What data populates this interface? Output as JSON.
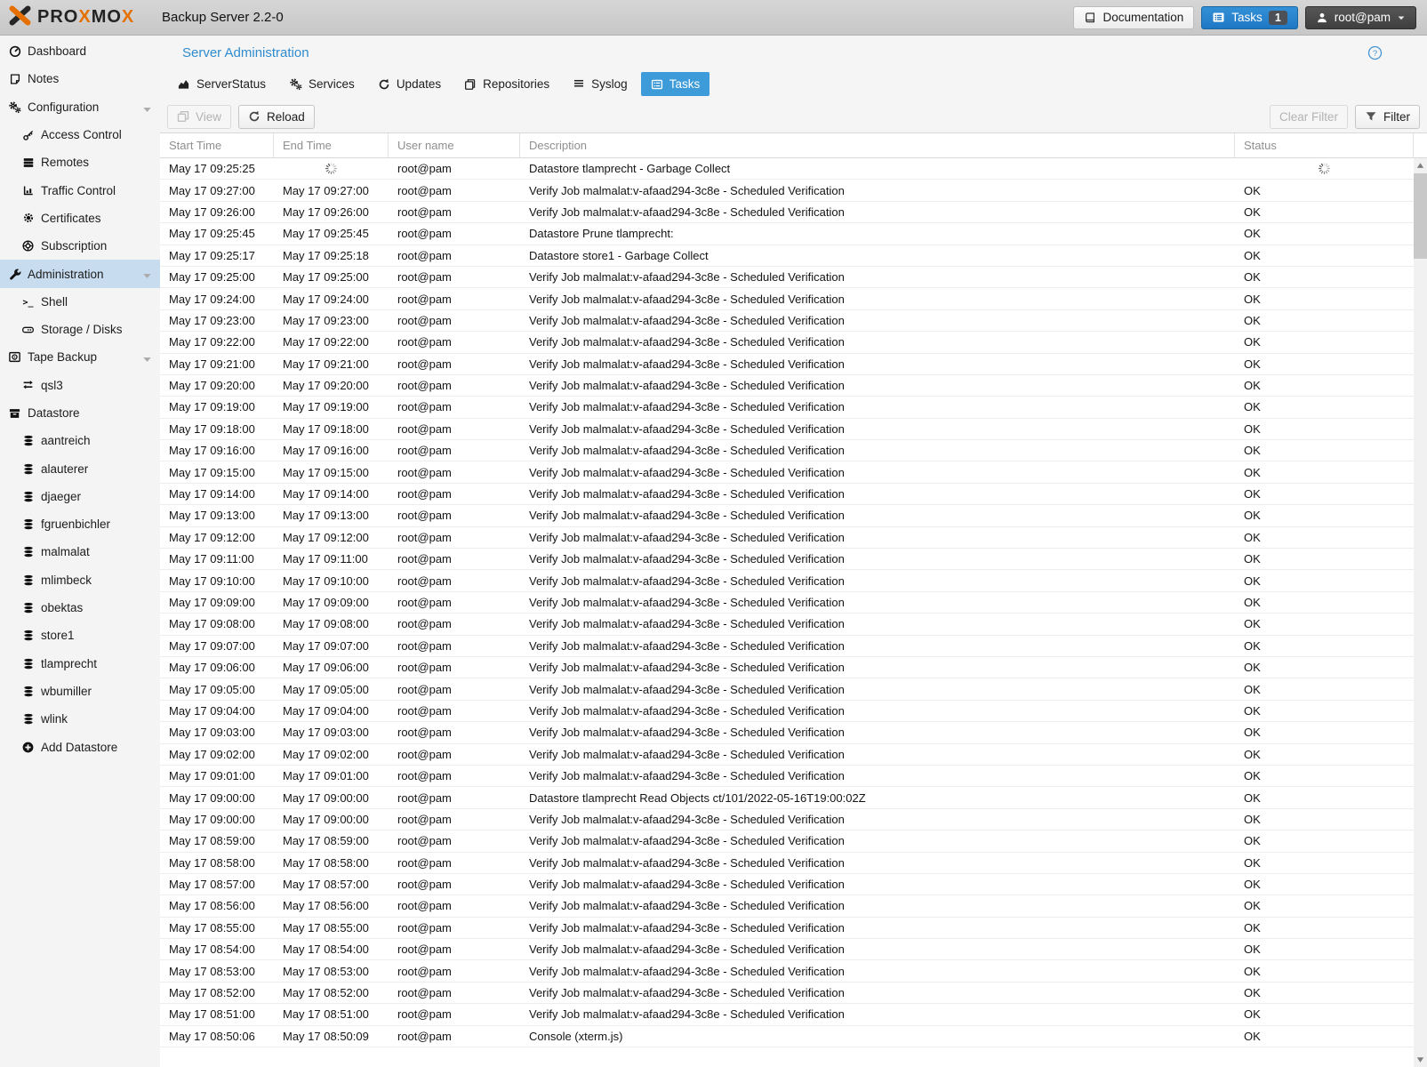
{
  "colors": {
    "accent_blue": "#3d9bd9",
    "logo_orange": "#e57000",
    "selected_item_bg": "#c8dcf0",
    "topbar_gray": "#cfcfcf"
  },
  "topbar": {
    "logo_parts": [
      {
        "t": "PRO",
        "c": "dark"
      },
      {
        "t": "X",
        "c": "orange"
      },
      {
        "t": "MO",
        "c": "dark"
      },
      {
        "t": "X",
        "c": "orange"
      }
    ],
    "subtitle": "Backup Server 2.2-0",
    "documentation_label": "Documentation",
    "tasks_label": "Tasks",
    "tasks_badge": "1",
    "user_label": "root@pam"
  },
  "sidebar": {
    "items": [
      {
        "label": "Dashboard",
        "icon": "dashboard-icon",
        "level": 0
      },
      {
        "label": "Notes",
        "icon": "note-icon",
        "level": 0
      },
      {
        "label": "Configuration",
        "icon": "gears-icon",
        "level": 0,
        "expandable": true
      },
      {
        "label": "Access Control",
        "icon": "key-icon",
        "level": 1
      },
      {
        "label": "Remotes",
        "icon": "remotes-icon",
        "level": 1
      },
      {
        "label": "Traffic Control",
        "icon": "traffic-chart-icon",
        "level": 1
      },
      {
        "label": "Certificates",
        "icon": "certificate-icon",
        "level": 1
      },
      {
        "label": "Subscription",
        "icon": "life-ring-icon",
        "level": 1
      },
      {
        "label": "Administration",
        "icon": "wrench-icon",
        "level": 0,
        "expandable": true,
        "selected": true
      },
      {
        "label": "Shell",
        "icon": "terminal-icon",
        "level": 1
      },
      {
        "label": "Storage / Disks",
        "icon": "hdd-icon",
        "level": 1
      },
      {
        "label": "Tape Backup",
        "icon": "tape-icon",
        "level": 0,
        "expandable": true
      },
      {
        "label": "qsl3",
        "icon": "exchange-icon",
        "level": 1
      },
      {
        "label": "Datastore",
        "icon": "archive-icon",
        "level": 0
      },
      {
        "label": "aantreich",
        "icon": "database-icon",
        "level": 1
      },
      {
        "label": "alauterer",
        "icon": "database-icon",
        "level": 1
      },
      {
        "label": "djaeger",
        "icon": "database-icon",
        "level": 1
      },
      {
        "label": "fgruenbichler",
        "icon": "database-icon",
        "level": 1
      },
      {
        "label": "malmalat",
        "icon": "database-icon",
        "level": 1
      },
      {
        "label": "mlimbeck",
        "icon": "database-icon",
        "level": 1
      },
      {
        "label": "obektas",
        "icon": "database-icon",
        "level": 1
      },
      {
        "label": "store1",
        "icon": "database-icon",
        "level": 1
      },
      {
        "label": "tlamprecht",
        "icon": "database-icon",
        "level": 1
      },
      {
        "label": "wbumiller",
        "icon": "database-icon",
        "level": 1
      },
      {
        "label": "wlink",
        "icon": "database-icon",
        "level": 1
      },
      {
        "label": "Add Datastore",
        "icon": "plus-circle-icon",
        "level": 1
      }
    ]
  },
  "main": {
    "title": "Server Administration",
    "tabs": [
      {
        "label": "ServerStatus",
        "icon": "chart-area-icon",
        "active": false
      },
      {
        "label": "Services",
        "icon": "gears-icon",
        "active": false
      },
      {
        "label": "Updates",
        "icon": "refresh-icon",
        "active": false
      },
      {
        "label": "Repositories",
        "icon": "copy-icon",
        "active": false
      },
      {
        "label": "Syslog",
        "icon": "list-icon",
        "active": false
      },
      {
        "label": "Tasks",
        "icon": "list-alt-icon",
        "active": true
      }
    ],
    "toolbar": {
      "view_label": "View",
      "reload_label": "Reload",
      "clear_filter_label": "Clear Filter",
      "filter_label": "Filter"
    },
    "table": {
      "columns": [
        "Start Time",
        "End Time",
        "User name",
        "Description",
        "Status"
      ],
      "rows": [
        {
          "start": "May 17 09:25:25",
          "end": "",
          "user": "root@pam",
          "desc": "Datastore tlamprecht - Garbage Collect",
          "status": "",
          "running": true
        },
        {
          "start": "May 17 09:27:00",
          "end": "May 17 09:27:00",
          "user": "root@pam",
          "desc": "Verify Job malmalat:v-afaad294-3c8e - Scheduled Verification",
          "status": "OK"
        },
        {
          "start": "May 17 09:26:00",
          "end": "May 17 09:26:00",
          "user": "root@pam",
          "desc": "Verify Job malmalat:v-afaad294-3c8e - Scheduled Verification",
          "status": "OK"
        },
        {
          "start": "May 17 09:25:45",
          "end": "May 17 09:25:45",
          "user": "root@pam",
          "desc": "Datastore Prune tlamprecht:",
          "status": "OK"
        },
        {
          "start": "May 17 09:25:17",
          "end": "May 17 09:25:18",
          "user": "root@pam",
          "desc": "Datastore store1 - Garbage Collect",
          "status": "OK"
        },
        {
          "start": "May 17 09:25:00",
          "end": "May 17 09:25:00",
          "user": "root@pam",
          "desc": "Verify Job malmalat:v-afaad294-3c8e - Scheduled Verification",
          "status": "OK"
        },
        {
          "start": "May 17 09:24:00",
          "end": "May 17 09:24:00",
          "user": "root@pam",
          "desc": "Verify Job malmalat:v-afaad294-3c8e - Scheduled Verification",
          "status": "OK"
        },
        {
          "start": "May 17 09:23:00",
          "end": "May 17 09:23:00",
          "user": "root@pam",
          "desc": "Verify Job malmalat:v-afaad294-3c8e - Scheduled Verification",
          "status": "OK"
        },
        {
          "start": "May 17 09:22:00",
          "end": "May 17 09:22:00",
          "user": "root@pam",
          "desc": "Verify Job malmalat:v-afaad294-3c8e - Scheduled Verification",
          "status": "OK"
        },
        {
          "start": "May 17 09:21:00",
          "end": "May 17 09:21:00",
          "user": "root@pam",
          "desc": "Verify Job malmalat:v-afaad294-3c8e - Scheduled Verification",
          "status": "OK"
        },
        {
          "start": "May 17 09:20:00",
          "end": "May 17 09:20:00",
          "user": "root@pam",
          "desc": "Verify Job malmalat:v-afaad294-3c8e - Scheduled Verification",
          "status": "OK"
        },
        {
          "start": "May 17 09:19:00",
          "end": "May 17 09:19:00",
          "user": "root@pam",
          "desc": "Verify Job malmalat:v-afaad294-3c8e - Scheduled Verification",
          "status": "OK"
        },
        {
          "start": "May 17 09:18:00",
          "end": "May 17 09:18:00",
          "user": "root@pam",
          "desc": "Verify Job malmalat:v-afaad294-3c8e - Scheduled Verification",
          "status": "OK"
        },
        {
          "start": "May 17 09:16:00",
          "end": "May 17 09:16:00",
          "user": "root@pam",
          "desc": "Verify Job malmalat:v-afaad294-3c8e - Scheduled Verification",
          "status": "OK"
        },
        {
          "start": "May 17 09:15:00",
          "end": "May 17 09:15:00",
          "user": "root@pam",
          "desc": "Verify Job malmalat:v-afaad294-3c8e - Scheduled Verification",
          "status": "OK"
        },
        {
          "start": "May 17 09:14:00",
          "end": "May 17 09:14:00",
          "user": "root@pam",
          "desc": "Verify Job malmalat:v-afaad294-3c8e - Scheduled Verification",
          "status": "OK"
        },
        {
          "start": "May 17 09:13:00",
          "end": "May 17 09:13:00",
          "user": "root@pam",
          "desc": "Verify Job malmalat:v-afaad294-3c8e - Scheduled Verification",
          "status": "OK"
        },
        {
          "start": "May 17 09:12:00",
          "end": "May 17 09:12:00",
          "user": "root@pam",
          "desc": "Verify Job malmalat:v-afaad294-3c8e - Scheduled Verification",
          "status": "OK"
        },
        {
          "start": "May 17 09:11:00",
          "end": "May 17 09:11:00",
          "user": "root@pam",
          "desc": "Verify Job malmalat:v-afaad294-3c8e - Scheduled Verification",
          "status": "OK"
        },
        {
          "start": "May 17 09:10:00",
          "end": "May 17 09:10:00",
          "user": "root@pam",
          "desc": "Verify Job malmalat:v-afaad294-3c8e - Scheduled Verification",
          "status": "OK"
        },
        {
          "start": "May 17 09:09:00",
          "end": "May 17 09:09:00",
          "user": "root@pam",
          "desc": "Verify Job malmalat:v-afaad294-3c8e - Scheduled Verification",
          "status": "OK"
        },
        {
          "start": "May 17 09:08:00",
          "end": "May 17 09:08:00",
          "user": "root@pam",
          "desc": "Verify Job malmalat:v-afaad294-3c8e - Scheduled Verification",
          "status": "OK"
        },
        {
          "start": "May 17 09:07:00",
          "end": "May 17 09:07:00",
          "user": "root@pam",
          "desc": "Verify Job malmalat:v-afaad294-3c8e - Scheduled Verification",
          "status": "OK"
        },
        {
          "start": "May 17 09:06:00",
          "end": "May 17 09:06:00",
          "user": "root@pam",
          "desc": "Verify Job malmalat:v-afaad294-3c8e - Scheduled Verification",
          "status": "OK"
        },
        {
          "start": "May 17 09:05:00",
          "end": "May 17 09:05:00",
          "user": "root@pam",
          "desc": "Verify Job malmalat:v-afaad294-3c8e - Scheduled Verification",
          "status": "OK"
        },
        {
          "start": "May 17 09:04:00",
          "end": "May 17 09:04:00",
          "user": "root@pam",
          "desc": "Verify Job malmalat:v-afaad294-3c8e - Scheduled Verification",
          "status": "OK"
        },
        {
          "start": "May 17 09:03:00",
          "end": "May 17 09:03:00",
          "user": "root@pam",
          "desc": "Verify Job malmalat:v-afaad294-3c8e - Scheduled Verification",
          "status": "OK"
        },
        {
          "start": "May 17 09:02:00",
          "end": "May 17 09:02:00",
          "user": "root@pam",
          "desc": "Verify Job malmalat:v-afaad294-3c8e - Scheduled Verification",
          "status": "OK"
        },
        {
          "start": "May 17 09:01:00",
          "end": "May 17 09:01:00",
          "user": "root@pam",
          "desc": "Verify Job malmalat:v-afaad294-3c8e - Scheduled Verification",
          "status": "OK"
        },
        {
          "start": "May 17 09:00:00",
          "end": "May 17 09:00:00",
          "user": "root@pam",
          "desc": "Datastore tlamprecht Read Objects ct/101/2022-05-16T19:00:02Z",
          "status": "OK"
        },
        {
          "start": "May 17 09:00:00",
          "end": "May 17 09:00:00",
          "user": "root@pam",
          "desc": "Verify Job malmalat:v-afaad294-3c8e - Scheduled Verification",
          "status": "OK"
        },
        {
          "start": "May 17 08:59:00",
          "end": "May 17 08:59:00",
          "user": "root@pam",
          "desc": "Verify Job malmalat:v-afaad294-3c8e - Scheduled Verification",
          "status": "OK"
        },
        {
          "start": "May 17 08:58:00",
          "end": "May 17 08:58:00",
          "user": "root@pam",
          "desc": "Verify Job malmalat:v-afaad294-3c8e - Scheduled Verification",
          "status": "OK"
        },
        {
          "start": "May 17 08:57:00",
          "end": "May 17 08:57:00",
          "user": "root@pam",
          "desc": "Verify Job malmalat:v-afaad294-3c8e - Scheduled Verification",
          "status": "OK"
        },
        {
          "start": "May 17 08:56:00",
          "end": "May 17 08:56:00",
          "user": "root@pam",
          "desc": "Verify Job malmalat:v-afaad294-3c8e - Scheduled Verification",
          "status": "OK"
        },
        {
          "start": "May 17 08:55:00",
          "end": "May 17 08:55:00",
          "user": "root@pam",
          "desc": "Verify Job malmalat:v-afaad294-3c8e - Scheduled Verification",
          "status": "OK"
        },
        {
          "start": "May 17 08:54:00",
          "end": "May 17 08:54:00",
          "user": "root@pam",
          "desc": "Verify Job malmalat:v-afaad294-3c8e - Scheduled Verification",
          "status": "OK"
        },
        {
          "start": "May 17 08:53:00",
          "end": "May 17 08:53:00",
          "user": "root@pam",
          "desc": "Verify Job malmalat:v-afaad294-3c8e - Scheduled Verification",
          "status": "OK"
        },
        {
          "start": "May 17 08:52:00",
          "end": "May 17 08:52:00",
          "user": "root@pam",
          "desc": "Verify Job malmalat:v-afaad294-3c8e - Scheduled Verification",
          "status": "OK"
        },
        {
          "start": "May 17 08:51:00",
          "end": "May 17 08:51:00",
          "user": "root@pam",
          "desc": "Verify Job malmalat:v-afaad294-3c8e - Scheduled Verification",
          "status": "OK"
        },
        {
          "start": "May 17 08:50:06",
          "end": "May 17 08:50:09",
          "user": "root@pam",
          "desc": "Console (xterm.js)",
          "status": "OK"
        }
      ]
    }
  }
}
